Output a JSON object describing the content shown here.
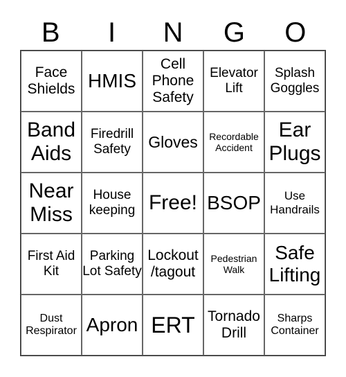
{
  "header": [
    "B",
    "I",
    "N",
    "G",
    "O"
  ],
  "cells": [
    [
      "Face Shields",
      "HMIS",
      "Cell Phone Safety",
      "Elevator Lift",
      "Splash Goggles"
    ],
    [
      "Band Aids",
      "Firedrill Safety",
      "Gloves",
      "Recordable Accident",
      "Ear Plugs"
    ],
    [
      "Near Miss",
      "House keeping",
      "Free!",
      "BSOP",
      "Use Handrails"
    ],
    [
      "First Aid Kit",
      "Parking Lot Safety",
      "Lockout /tagout",
      "Pedestrian Walk",
      "Safe Lifting"
    ],
    [
      "Dust Respirator",
      "Apron",
      "ERT",
      "Tornado Drill",
      "Sharps Container"
    ]
  ]
}
